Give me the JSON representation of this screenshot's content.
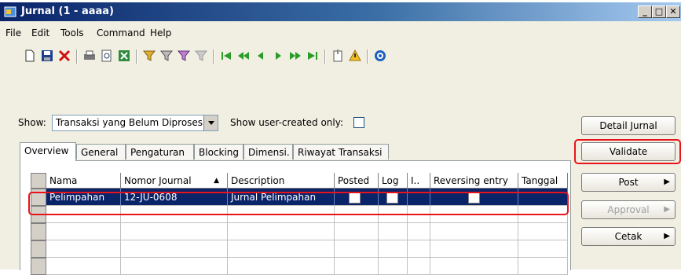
{
  "window": {
    "title": "Jurnal (1 - aaaa)"
  },
  "menu": [
    "File",
    "Edit",
    "Tools",
    "Command",
    "Help"
  ],
  "toolbar_icons": [
    "new-icon",
    "save-icon",
    "delete-icon",
    "print-icon",
    "print-preview-icon",
    "export-excel-icon",
    "filter-icon",
    "filter-by-selection-icon",
    "advanced-filter-icon",
    "remove-filter-icon",
    "first-record-icon",
    "previous-page-icon",
    "previous-record-icon",
    "next-record-icon",
    "next-page-icon",
    "last-record-icon",
    "attachment-icon",
    "alert-icon",
    "help-icon"
  ],
  "filter": {
    "show_label": "Show:",
    "show_value": "Transaksi yang Belum Diproses",
    "user_created_label": "Show user-created only:"
  },
  "tabs": [
    "Overview",
    "General",
    "Pengaturan",
    "Blocking",
    "Dimensi.",
    "Riwayat Transaksi"
  ],
  "grid": {
    "columns": [
      "Nama",
      "Nomor Journal",
      "Description",
      "Posted",
      "Log",
      "I..",
      "Reversing entry",
      "Tanggal"
    ],
    "rows": [
      {
        "nama": "Pelimpahan",
        "nomor": "12-JU-0608",
        "description": "Jurnal Pelimpahan",
        "posted": false,
        "log": false,
        "reversing": false,
        "tanggal": ""
      }
    ]
  },
  "buttons": {
    "detail": "Detail Jurnal",
    "validate": "Validate",
    "post": "Post",
    "approval": "Approval",
    "cetak": "Cetak"
  },
  "colors": {
    "title_bar": "#0a246a",
    "selection": "#0a246a",
    "highlight": "#e8141b"
  }
}
